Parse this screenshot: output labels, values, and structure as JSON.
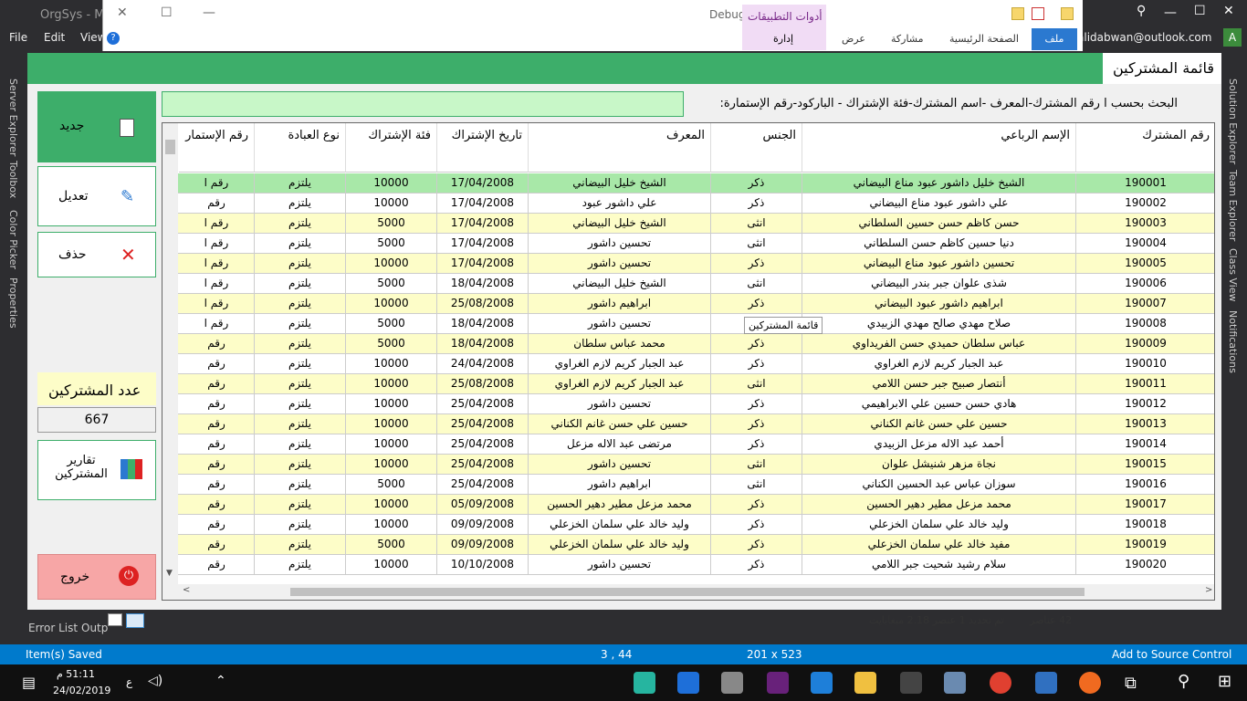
{
  "vs": {
    "title": "OrgSys - Mic",
    "menu": [
      "File",
      "Edit",
      "View"
    ],
    "left_tabs": [
      "Server Explorer",
      "Toolbox",
      "Color Picker",
      "Properties"
    ],
    "right_tabs": [
      "Solution Explorer",
      "Team Explorer",
      "Class View",
      "Notifications"
    ],
    "bottom_tabs": [
      "Error List",
      "Outp"
    ],
    "debug": "Debug",
    "account": "alidabwan@outlook.com",
    "avatar_letter": "A"
  },
  "ribbon": {
    "apptools_label": "أدوات التطبيقات",
    "apptools_sub": "إدارة",
    "tabs": [
      "عرض",
      "مشاركة",
      "الصفحة الرئيسية"
    ],
    "file_tab": "ملف"
  },
  "form": {
    "title": "قائمة المشتركين",
    "search_label": "البحث بحسب  ا رقم المشترك-المعرف -اسم المشترك-فئة الإشتراك - الباركود-رقم الإستمارة:",
    "buttons": {
      "new": "جديد",
      "edit": "تعديل",
      "delete": "حذف",
      "reports": "تقارير المشتركين",
      "exit": "خروج"
    },
    "count_label": "عدد المشتركين",
    "count_value": "667",
    "tooltip": "قائمة المشتركين",
    "status_count": "42 عناصر",
    "status_selected": "تم تحديد 1 عنصر  2.18 ميغابايت"
  },
  "grid": {
    "headers": [
      "رقم المشترك",
      "الإسم الرباعي",
      "الجنس",
      "المعرف",
      "تاريخ الإشتراك",
      "فئة الإشتراك",
      "نوع العبادة",
      "رقم الإستمار"
    ],
    "rows": [
      [
        "190001",
        "الشيخ خليل داشور عبود مناع البيضاني",
        "ذكر",
        "الشيخ خليل البيضاني",
        "17/04/2008",
        "10000",
        "يلتزم",
        "رقم ا"
      ],
      [
        "190002",
        "علي داشور عبود مناع البيضاني",
        "ذكر",
        "علي داشور عبود",
        "17/04/2008",
        "10000",
        "يلتزم",
        "رقم"
      ],
      [
        "190003",
        "حسن كاظم حسن حسين السلطاني",
        "انثى",
        "الشيخ خليل البيضاني",
        "17/04/2008",
        "5000",
        "يلتزم",
        "رقم ا"
      ],
      [
        "190004",
        "دنيا حسين كاظم حسن السلطاني",
        "انثى",
        "تحسين داشور",
        "17/04/2008",
        "5000",
        "يلتزم",
        "رقم ا"
      ],
      [
        "190005",
        "تحسين داشور عبود مناع البيضاني",
        "ذكر",
        "تحسين داشور",
        "17/04/2008",
        "10000",
        "يلتزم",
        "رقم ا"
      ],
      [
        "190006",
        "شذى علوان جبر بندر البيضاني",
        "انثى",
        "الشيخ خليل البيضاني",
        "18/04/2008",
        "5000",
        "يلتزم",
        "رقم ا"
      ],
      [
        "190007",
        "ابراهيم داشور عبود البيضاني",
        "ذكر",
        "ابراهيم داشور",
        "25/08/2008",
        "10000",
        "يلتزم",
        "رقم ا"
      ],
      [
        "190008",
        "صلاح مهدي صالح مهدي الزبيدي",
        "",
        "تحسين داشور",
        "18/04/2008",
        "5000",
        "يلتزم",
        "رقم ا"
      ],
      [
        "190009",
        "عباس سلطان حميدي حسن الفريداوي",
        "ذكر",
        "محمد عباس سلطان",
        "18/04/2008",
        "5000",
        "يلتزم",
        "رقم"
      ],
      [
        "190010",
        "عبد الجبار كريم لازم الغراوي",
        "ذكر",
        "عبد الجبار كريم لازم الغراوي",
        "24/04/2008",
        "10000",
        "يلتزم",
        "رقم"
      ],
      [
        "190011",
        "أنتصار صبيح جبر حسن اللامي",
        "انثى",
        "عبد الجبار كريم لازم الغراوي",
        "25/08/2008",
        "10000",
        "يلتزم",
        "رقم"
      ],
      [
        "190012",
        "هادي حسن حسين علي الابراهيمي",
        "ذكر",
        "تحسين داشور",
        "25/04/2008",
        "10000",
        "يلتزم",
        "رقم"
      ],
      [
        "190013",
        "حسين علي حسن غانم الكناني",
        "ذكر",
        "حسين علي حسن غانم الكناني",
        "25/04/2008",
        "10000",
        "يلتزم",
        "رقم"
      ],
      [
        "190014",
        "أحمد عبد الاله مزعل الزبيدي",
        "ذكر",
        "مرتضى عبد الاله مزعل",
        "25/04/2008",
        "10000",
        "يلتزم",
        "رقم"
      ],
      [
        "190015",
        "نجاة مزهر شنيشل علوان",
        "انثى",
        "تحسين داشور",
        "25/04/2008",
        "10000",
        "يلتزم",
        "رقم"
      ],
      [
        "190016",
        "سوزان عباس عبد الحسين الكناني",
        "انثى",
        "ابراهيم داشور",
        "25/04/2008",
        "5000",
        "يلتزم",
        "رقم"
      ],
      [
        "190017",
        "محمد مزعل مطير دهير الحسين",
        "ذكر",
        "محمد مزعل مطير دهير الحسين",
        "05/09/2008",
        "10000",
        "يلتزم",
        "رقم"
      ],
      [
        "190018",
        "وليد خالد علي سلمان الخزعلي",
        "ذكر",
        "وليد خالد علي سلمان الخزعلي",
        "09/09/2008",
        "10000",
        "يلتزم",
        "رقم"
      ],
      [
        "190019",
        "مفيد خالد علي سلمان الخزعلي",
        "ذكر",
        "وليد خالد علي سلمان الخزعلي",
        "09/09/2008",
        "5000",
        "يلتزم",
        "رقم"
      ],
      [
        "190020",
        "سلام رشيد شحيت جبر اللامي",
        "ذكر",
        "تحسين داشور",
        "10/10/2008",
        "10000",
        "يلتزم",
        "رقم"
      ]
    ]
  },
  "statusbar": {
    "saved": "Item(s) Saved",
    "pos": "3 , 44",
    "size": "201 x 523",
    "source": "Add to Source Control"
  },
  "taskbar": {
    "time": "51:11 م",
    "date": "24/02/2019",
    "lang": "ع"
  },
  "colors": {
    "green": "#3dae6a",
    "row_alt": "#fdfdc8",
    "row_sel": "#a8e8a8",
    "vs_blue": "#007acc"
  }
}
